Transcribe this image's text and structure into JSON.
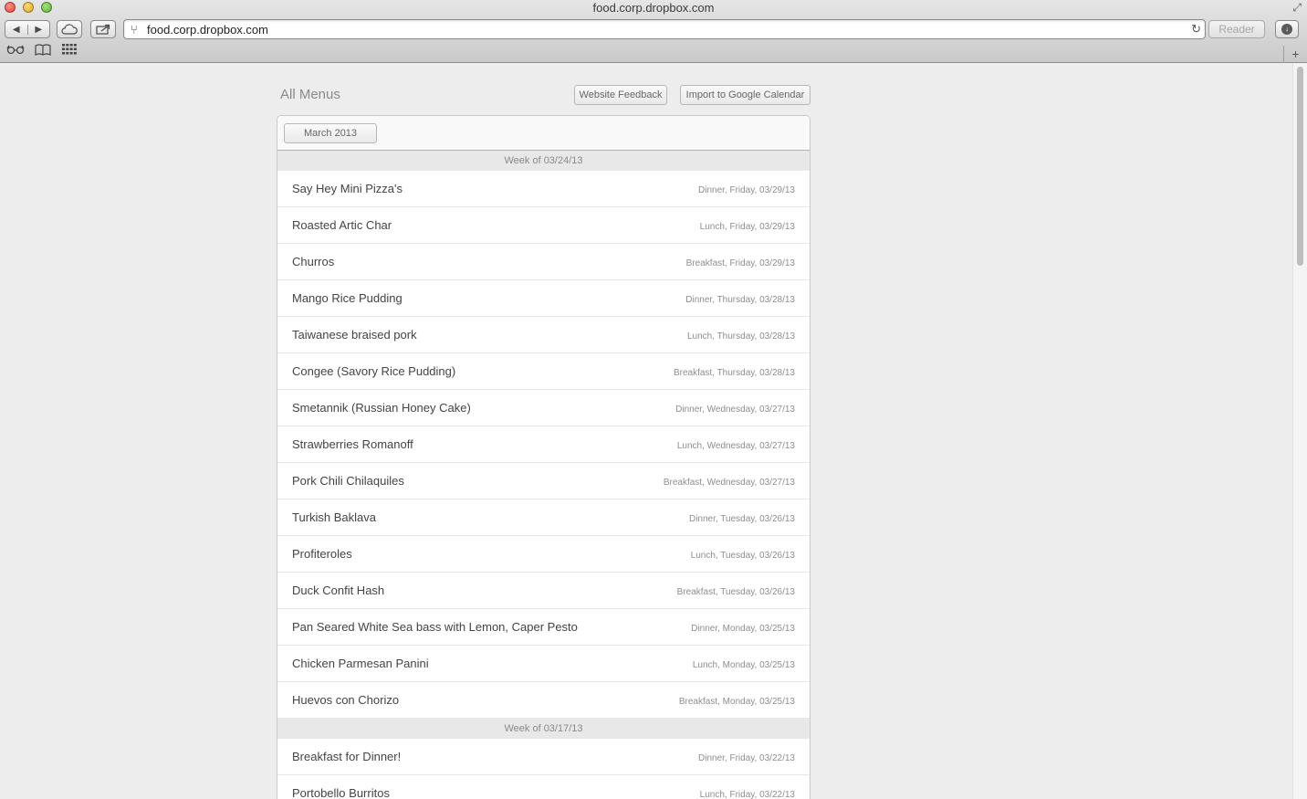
{
  "browser": {
    "window_title": "food.corp.dropbox.com",
    "url": "food.corp.dropbox.com",
    "reader_label": "Reader",
    "back_icon": "◀",
    "forward_icon": "▶",
    "icons": [
      "back-icon",
      "forward-icon",
      "icloud-icon",
      "share-icon",
      "reload-icon",
      "download-icon",
      "reading-list-icon",
      "bookmarks-icon",
      "top-sites-icon",
      "new-tab-icon"
    ]
  },
  "page": {
    "title": "All Menus",
    "feedback_label": "Website Feedback",
    "gcal_label": "Import to Google Calendar",
    "month_label": "March 2013"
  },
  "weeks": [
    {
      "label": "Week of 03/24/13",
      "items": [
        {
          "name": "Say Hey Mini Pizza's",
          "meta": "Dinner, Friday, 03/29/13"
        },
        {
          "name": "Roasted Artic Char",
          "meta": "Lunch, Friday, 03/29/13"
        },
        {
          "name": "Churros",
          "meta": "Breakfast, Friday, 03/29/13"
        },
        {
          "name": "Mango Rice Pudding",
          "meta": "Dinner, Thursday, 03/28/13"
        },
        {
          "name": "Taiwanese braised pork",
          "meta": "Lunch, Thursday, 03/28/13"
        },
        {
          "name": "Congee (Savory Rice Pudding)",
          "meta": "Breakfast, Thursday, 03/28/13"
        },
        {
          "name": "Smetannik (Russian Honey Cake)",
          "meta": "Dinner, Wednesday, 03/27/13"
        },
        {
          "name": "Strawberries Romanoff",
          "meta": "Lunch, Wednesday, 03/27/13"
        },
        {
          "name": "Pork Chili Chilaquiles",
          "meta": "Breakfast, Wednesday, 03/27/13"
        },
        {
          "name": "Turkish Baklava",
          "meta": "Dinner, Tuesday, 03/26/13"
        },
        {
          "name": "Profiteroles",
          "meta": "Lunch, Tuesday, 03/26/13"
        },
        {
          "name": "Duck Confit Hash",
          "meta": "Breakfast, Tuesday, 03/26/13"
        },
        {
          "name": "Pan Seared White Sea bass with Lemon, Caper Pesto",
          "meta": "Dinner, Monday, 03/25/13"
        },
        {
          "name": "Chicken Parmesan Panini",
          "meta": "Lunch, Monday, 03/25/13"
        },
        {
          "name": "Huevos con Chorizo",
          "meta": "Breakfast, Monday, 03/25/13"
        }
      ]
    },
    {
      "label": "Week of 03/17/13",
      "items": [
        {
          "name": "Breakfast for Dinner!",
          "meta": "Dinner, Friday, 03/22/13"
        },
        {
          "name": "Portobello Burritos",
          "meta": "Lunch, Friday, 03/22/13"
        }
      ]
    }
  ]
}
